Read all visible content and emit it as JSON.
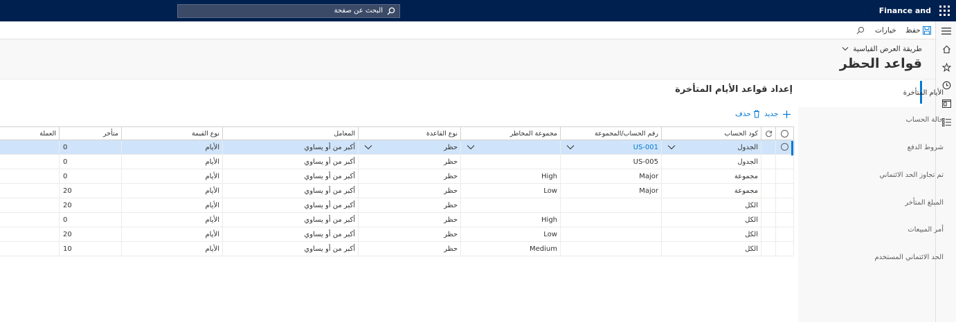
{
  "app": {
    "title": "Finance and Operations"
  },
  "search": {
    "placeholder": "البحث عن صفحة"
  },
  "actions": {
    "save": "حفظ",
    "options": "خيارات"
  },
  "header": {
    "view": "طريقة العرض القياسية",
    "title": "قواعد الحظر"
  },
  "tabs": [
    {
      "label": "الأيام المتأخرة",
      "active": true
    },
    {
      "label": "حالة الحساب"
    },
    {
      "label": "شروط الدفع"
    },
    {
      "label": "تم تجاوز الحد الائتماني"
    },
    {
      "label": "المبلغ المتأخر"
    },
    {
      "label": "أمر المبيعات"
    },
    {
      "label": "الحد الائتماني المستخدم"
    }
  ],
  "section": {
    "title": "إعداد قواعد الأيام المتأخرة",
    "new_label": "جديد",
    "delete_label": "حذف"
  },
  "grid": {
    "columns": [
      "كود الحساب",
      "رقم الحساب/المجموعة",
      "مجموعة المخاطر",
      "نوع القاعدة",
      "المعامل",
      "نوع القيمة",
      "متأخر",
      "العملة"
    ],
    "rows": [
      {
        "code": "الجدول",
        "account": "US-001",
        "risk": "",
        "rule": "حظر",
        "op": "أكبر من أو يساوي",
        "vtype": "الأيام",
        "late": "0",
        "currency": "",
        "selected": true
      },
      {
        "code": "الجدول",
        "account": "US-005",
        "risk": "",
        "rule": "حظر",
        "op": "أكبر من أو يساوي",
        "vtype": "الأيام",
        "late": "0",
        "currency": ""
      },
      {
        "code": "مجموعة",
        "account": "Major",
        "risk": "High",
        "rule": "حظر",
        "op": "أكبر من أو يساوي",
        "vtype": "الأيام",
        "late": "0",
        "currency": ""
      },
      {
        "code": "مجموعة",
        "account": "Major",
        "risk": "Low",
        "rule": "حظر",
        "op": "أكبر من أو يساوي",
        "vtype": "الأيام",
        "late": "20",
        "currency": ""
      },
      {
        "code": "الكل",
        "account": "",
        "risk": "",
        "rule": "حظر",
        "op": "أكبر من أو يساوي",
        "vtype": "الأيام",
        "late": "20",
        "currency": ""
      },
      {
        "code": "الكل",
        "account": "",
        "risk": "High",
        "rule": "حظر",
        "op": "أكبر من أو يساوي",
        "vtype": "الأيام",
        "late": "0",
        "currency": ""
      },
      {
        "code": "الكل",
        "account": "",
        "risk": "Low",
        "rule": "حظر",
        "op": "أكبر من أو يساوي",
        "vtype": "الأيام",
        "late": "20",
        "currency": ""
      },
      {
        "code": "الكل",
        "account": "",
        "risk": "Medium",
        "rule": "حظر",
        "op": "أكبر من أو يساوي",
        "vtype": "الأيام",
        "late": "10",
        "currency": ""
      }
    ]
  },
  "colors": {
    "topbar": "#002050",
    "accent": "#0078d4",
    "selected_row": "#cfe4fa"
  },
  "icons": [
    "waffle-icon",
    "search-icon",
    "save-icon",
    "hamburger-icon",
    "home-icon",
    "star-icon",
    "clock-icon",
    "workspace-icon",
    "list-icon",
    "plus-icon",
    "trash-icon",
    "chevron-down-icon",
    "refresh-icon"
  ]
}
